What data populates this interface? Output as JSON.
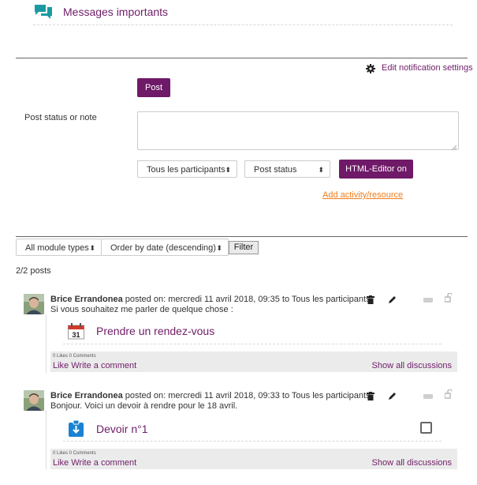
{
  "header": {
    "title": "Messages importants",
    "icon": "chat-bubbles-icon"
  },
  "notifications": {
    "settings_label": "Edit notification settings"
  },
  "composer": {
    "post_label": "Post",
    "status_label": "Post status or note",
    "audience_value": "Tous les participants",
    "type_value": "Post status",
    "editor_label": "HTML-Editor on",
    "add_link": "Add activity/resource"
  },
  "filters": {
    "module_types": "All module types",
    "order": "Order by date (descending)",
    "filter_label": "Filter",
    "count_label": "2/2 posts"
  },
  "posts": [
    {
      "author": "Brice Errandonea",
      "meta": "posted on: mercredi 11 avril 2018, 09:35 to Tous les participants",
      "body": "Si vous souhaitez me parler de quelque chose :",
      "activity": "Prendre un rendez-vous",
      "activity_icon": "calendar-icon",
      "calendar_day": "31",
      "counts": "0 Likes   0 Comments",
      "like": "Like",
      "comment": "Write a comment",
      "discussions": "Show all discussions"
    },
    {
      "author": "Brice Errandonea",
      "meta": "posted on: mercredi 11 avril 2018, 09:33 to Tous les participants",
      "body": "Bonjour. Voici un devoir à rendre pour le 18 avril.",
      "activity": "Devoir n°1",
      "activity_icon": "assignment-icon",
      "counts": "0 Likes   0 Comments",
      "like": "Like",
      "comment": "Write a comment",
      "discussions": "Show all discussions"
    }
  ],
  "colors": {
    "brand": "#6f1a68",
    "link_orange": "#f07d1a",
    "teal_icon": "#1a9aa0"
  }
}
